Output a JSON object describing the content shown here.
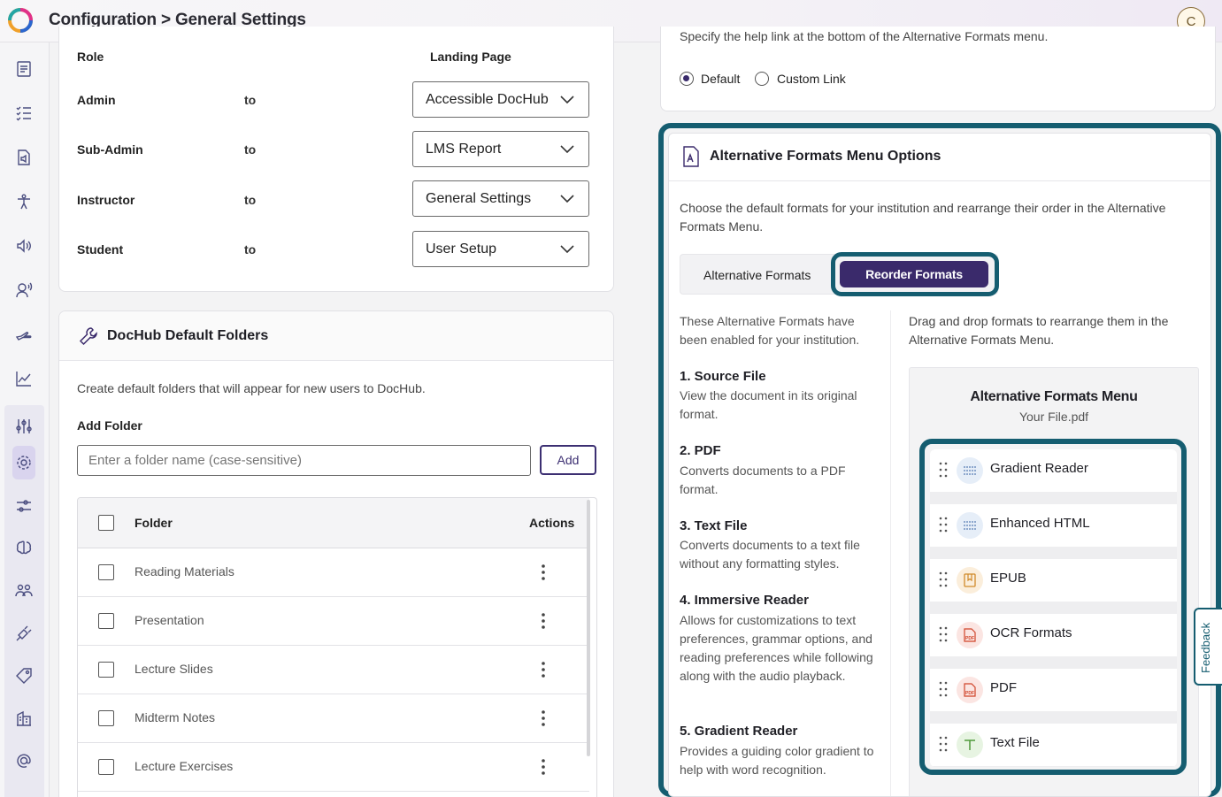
{
  "header": {
    "breadcrumb": "Configuration > General Settings",
    "avatar_initial": "C"
  },
  "sidebar": {
    "icons": [
      "document-icon",
      "checklist-icon",
      "audio-file-icon",
      "accessibility-icon",
      "speaker-icon",
      "voice-user-icon",
      "hand-icon",
      "chart-icon",
      "sliders-icon",
      "gear-icon",
      "adjust-icon",
      "brain-icon",
      "users-icon",
      "plug-icon",
      "tag-icon",
      "building-icon",
      "at-sign-icon"
    ],
    "active": "gear-icon"
  },
  "landing": {
    "role_header": "Role",
    "page_header": "Landing Page",
    "rows": [
      {
        "role": "Admin",
        "to": "to",
        "page": "Accessible DocHub"
      },
      {
        "role": "Sub-Admin",
        "to": "to",
        "page": "LMS Report"
      },
      {
        "role": "Instructor",
        "to": "to",
        "page": "General Settings"
      },
      {
        "role": "Student",
        "to": "to",
        "page": "User Setup"
      }
    ]
  },
  "folders": {
    "title": "DocHub Default Folders",
    "description": "Create default folders that will appear for new users to DocHub.",
    "add_label": "Add Folder",
    "input_placeholder": "Enter a folder name (case-sensitive)",
    "add_button": "Add",
    "col_folder": "Folder",
    "col_actions": "Actions",
    "rows": [
      "Reading Materials",
      "Presentation",
      "Lecture Slides",
      "Midterm Notes",
      "Lecture Exercises"
    ]
  },
  "help_link": {
    "text": "Specify the help link at the bottom of the Alternative Formats menu.",
    "options": [
      "Default",
      "Custom Link"
    ],
    "selected": "Default"
  },
  "alt_formats": {
    "title": "Alternative Formats Menu Options",
    "description": "Choose the default formats for your institution and rearrange their order in the Alternative Formats Menu.",
    "tab_alt": "Alternative Formats",
    "tab_reorder": "Reorder Formats",
    "left_intro": "These Alternative Formats have been enabled for your institution.",
    "right_intro": "Drag and drop formats to rearrange them in the Alternative Formats Menu.",
    "formats": [
      {
        "title": "1. Source File",
        "desc": "View the document in its original format."
      },
      {
        "title": "2. PDF",
        "desc": "Converts documents to a PDF format."
      },
      {
        "title": "3. Text File",
        "desc": "Converts documents to a text file without any formatting styles."
      },
      {
        "title": "4. Immersive Reader",
        "desc": "Allows for customizations to text preferences, grammar options, and reading preferences while following along with the audio playback."
      },
      {
        "title": "5. Gradient Reader",
        "desc": "Provides a guiding color gradient to help with word recognition."
      }
    ],
    "menu_title": "Alternative Formats Menu",
    "menu_file": "Your File.pdf",
    "menu_items": [
      {
        "label": "Gradient Reader",
        "icon": "lines-icon"
      },
      {
        "label": "Enhanced HTML",
        "icon": "lines-icon"
      },
      {
        "label": "EPUB",
        "icon": "book-icon"
      },
      {
        "label": "OCR Formats",
        "icon": "pdf-icon"
      },
      {
        "label": "PDF",
        "icon": "pdf-icon"
      },
      {
        "label": "Text File",
        "icon": "text-icon"
      }
    ]
  },
  "feedback": {
    "label": "Feedback"
  },
  "colors": {
    "accent": "#155d70",
    "primary": "#3a2a6b"
  }
}
